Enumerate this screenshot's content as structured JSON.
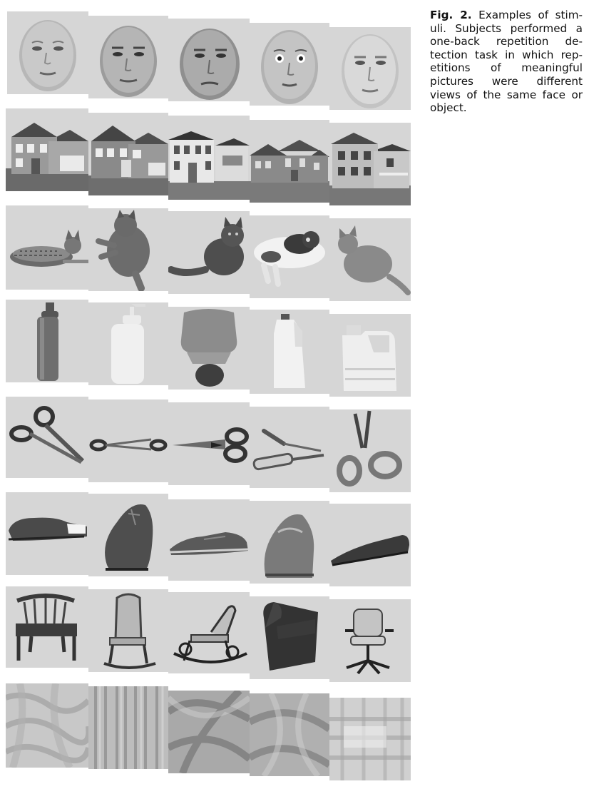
{
  "figure": {
    "label": "Fig. 2.",
    "caption": "Examples of stim- uli. Subjects performed a one-back repetition de- tection task in which rep- etitions of meaningful pictures were different views of the same face or object."
  },
  "rows": [
    {
      "category": "faces",
      "items": [
        "face-1",
        "face-2",
        "face-3",
        "face-4",
        "face-5"
      ]
    },
    {
      "category": "houses",
      "items": [
        "house-1",
        "house-2",
        "house-3",
        "house-4",
        "house-5"
      ]
    },
    {
      "category": "cats",
      "items": [
        "cat-1",
        "cat-2",
        "cat-3",
        "cat-4",
        "cat-5"
      ]
    },
    {
      "category": "bottles",
      "items": [
        "bottle-1",
        "bottle-2",
        "bottle-3",
        "bottle-4",
        "bottle-5"
      ]
    },
    {
      "category": "scissors",
      "items": [
        "scissors-1",
        "scissors-2",
        "scissors-3",
        "scissors-4",
        "scissors-5"
      ]
    },
    {
      "category": "shoes",
      "items": [
        "shoe-1",
        "shoe-2",
        "shoe-3",
        "shoe-4",
        "shoe-5"
      ]
    },
    {
      "category": "chairs",
      "items": [
        "chair-1",
        "chair-2",
        "chair-3",
        "chair-4",
        "chair-5"
      ]
    },
    {
      "category": "scrambled",
      "items": [
        "scrambled-1",
        "scrambled-2",
        "scrambled-3",
        "scrambled-4",
        "scrambled-5"
      ]
    }
  ]
}
